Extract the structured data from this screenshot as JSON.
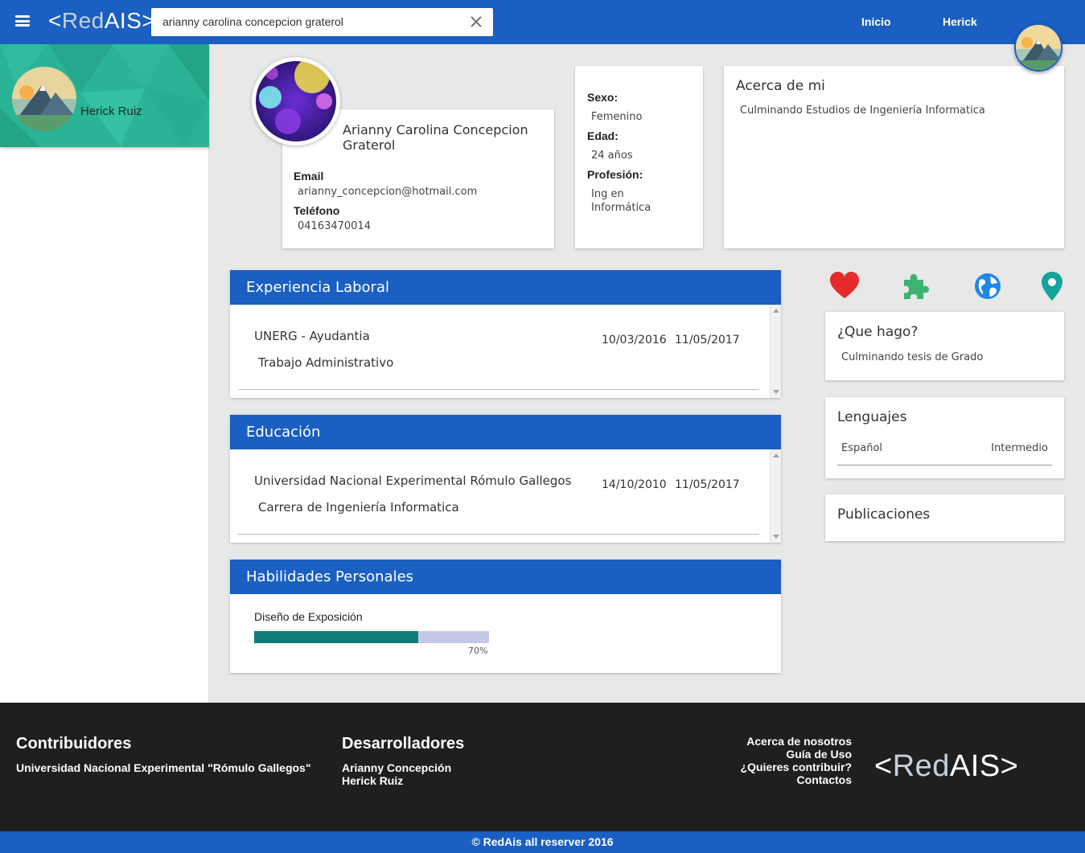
{
  "header": {
    "logo_left": "<",
    "logo_red": "Red",
    "logo_ais": "AIS",
    "logo_right": ">",
    "search_value": "arianny carolina concepcion graterol",
    "nav_home": "Inicio",
    "nav_user": "Herick"
  },
  "sidebar": {
    "user_name": "Herick Ruiz"
  },
  "profile": {
    "name": "Arianny Carolina Concepcion Graterol",
    "email_label": "Email",
    "email": "arianny_concepcion@hotmail.com",
    "phone_label": "Teléfono",
    "phone": "04163470014"
  },
  "info": {
    "sex_label": "Sexo:",
    "sex": "Femenino",
    "age_label": "Edad:",
    "age": "24 años",
    "profession_label": "Profesión:",
    "profession": "Ing en Informática"
  },
  "about": {
    "title": "Acerca de mi",
    "text": "Culminando Estudios de Ingeniería Informatica"
  },
  "experience": {
    "title": "Experiencia Laboral",
    "items": [
      {
        "title": "UNERG - Ayudantia",
        "subtitle": "Trabajo Administrativo",
        "start": "10/03/2016",
        "end": "11/05/2017"
      }
    ]
  },
  "education": {
    "title": "Educación",
    "items": [
      {
        "title": "Universidad Nacional Experimental Rómulo Gallegos",
        "subtitle": "Carrera de Ingeniería Informatica",
        "start": "14/10/2010",
        "end": "11/05/2017"
      }
    ]
  },
  "skills": {
    "title": "Habilidades Personales",
    "items": [
      {
        "name": "Diseño de Exposición",
        "level": 0.7,
        "level_label": "70%"
      }
    ]
  },
  "icons": [
    "heart-icon",
    "puzzle-icon",
    "globe-icon",
    "location-pin-icon"
  ],
  "colors": {
    "primary": "#1a5fc1",
    "sidebar_header": "#2ab395",
    "heart": "#e62b2b",
    "puzzle": "#3cb371",
    "globe": "#1e88e5",
    "pin": "#14a39a",
    "skill_fill": "#127e78",
    "skill_track": "#c5c8e6",
    "footer": "#1f1f1f"
  },
  "quehago": {
    "title": "¿Que hago?",
    "text": "Culminando tesis de Grado"
  },
  "languages": {
    "title": "Lenguajes",
    "items": [
      {
        "name": "Español",
        "level": "Intermedio"
      }
    ]
  },
  "publications": {
    "title": "Publicaciones"
  },
  "footer": {
    "contrib_title": "Contribuidores",
    "contrib_text": "Universidad Nacional Experimental \"Rómulo Gallegos\"",
    "dev_title": "Desarrolladores",
    "dev_1": "Arianny Concepción",
    "dev_2": "Herick Ruiz",
    "links": [
      "Acerca de nosotros",
      "Guía de Uso",
      "¿Quieres contribuir?",
      "Contactos"
    ],
    "copyright": "© RedAis all reserver 2016"
  }
}
